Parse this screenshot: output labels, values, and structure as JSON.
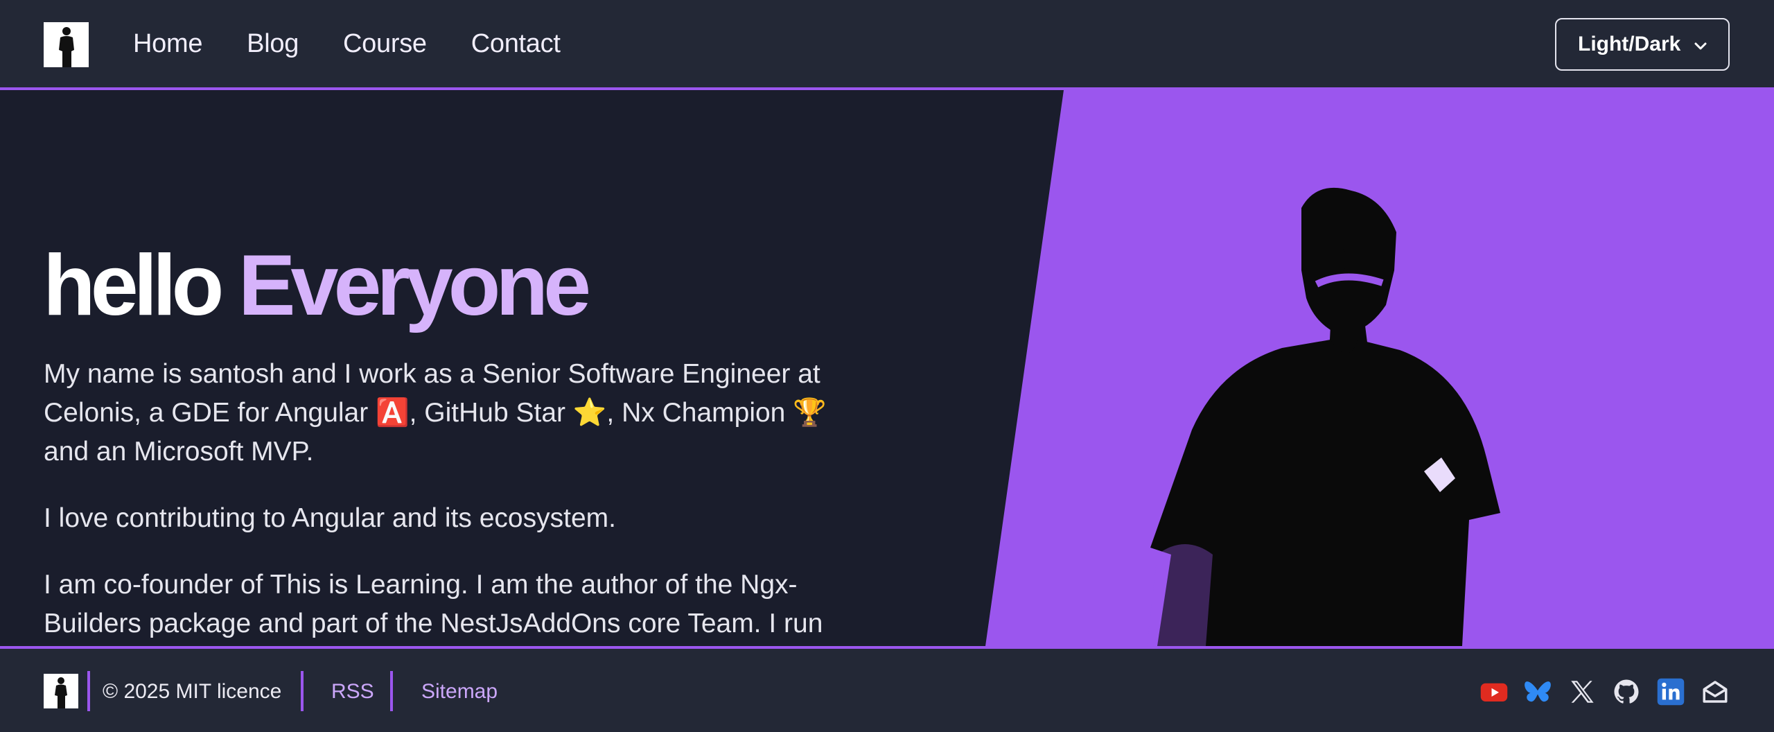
{
  "header": {
    "nav": [
      {
        "label": "Home"
      },
      {
        "label": "Blog"
      },
      {
        "label": "Course"
      },
      {
        "label": "Contact"
      }
    ],
    "theme_button": "Light/Dark"
  },
  "hero": {
    "title_part1": "hello",
    "title_part2": "Everyone",
    "paragraphs": [
      "My name is santosh and I work as a Senior Software Engineer at Celonis, a GDE for Angular 🅰️, GitHub Star ⭐, Nx Champion 🏆 and an Microsoft MVP.",
      "I love contributing to Angular and its ecosystem.",
      "I am co-founder of This is Learning. I am the author of the Ngx-Builders package and part of the NestJsAddOns core Team. I run"
    ]
  },
  "footer": {
    "copyright": "© 2025 MIT licence",
    "links": [
      {
        "label": "RSS"
      },
      {
        "label": "Sitemap"
      }
    ],
    "social_icons": [
      "youtube-icon",
      "bluesky-icon",
      "x-twitter-icon",
      "github-icon",
      "linkedin-icon",
      "email-icon"
    ]
  },
  "colors": {
    "accent": "#9b56ee",
    "title_accent": "#d6b3fb",
    "background": "#1a1d2c",
    "header_bg": "#232836"
  }
}
